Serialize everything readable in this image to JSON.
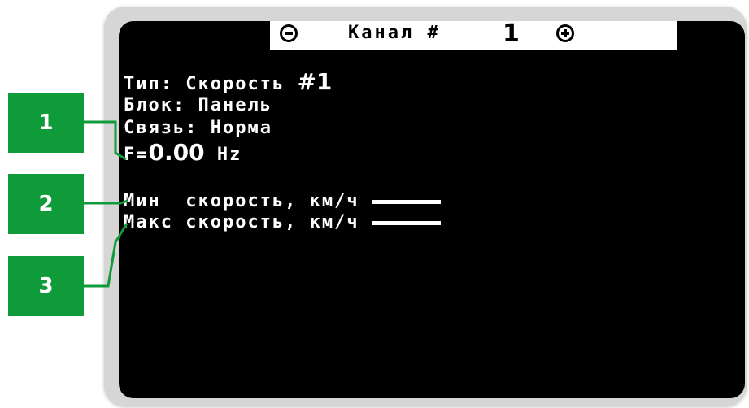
{
  "header": {
    "title": "Канал #",
    "channel_number": "1",
    "minus_icon": "minus-circle-icon",
    "plus_icon": "plus-circle-icon"
  },
  "info": {
    "type_label": "Тип:",
    "type_value": "Скорость",
    "type_number": "#1",
    "block_label": "Блок:",
    "block_value": "Панель",
    "link_label": "Связь:",
    "link_value": "Норма",
    "freq_prefix": "F=",
    "freq_value": "0.00",
    "freq_unit": "Hz"
  },
  "settings": {
    "min_label": "Мин  скорость, км/ч",
    "max_label": "Макс скорость, км/ч"
  },
  "callouts": [
    "1",
    "2",
    "3"
  ],
  "colors": {
    "screen": "#000000",
    "text": "#ffffff",
    "header_bg": "#ffffff",
    "callout": "#109b3b",
    "bezel": "#d6d6d6"
  }
}
